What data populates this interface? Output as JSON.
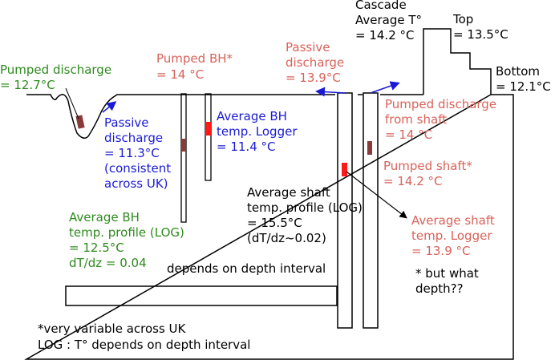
{
  "colors": {
    "green": "#2e8b1e",
    "salmon": "#d9625a",
    "blue": "#1a1ad6",
    "black": "#000000",
    "logger_red": "#ff1a1a",
    "logger_brown": "#8b3a3a"
  },
  "labels": {
    "pumped_discharge": [
      "Pumped discharge",
      "= 12.7°C"
    ],
    "pumped_bh": [
      "Pumped BH*",
      "= 14 °C"
    ],
    "passive_discharge_top": [
      "Passive",
      "discharge",
      "= 13.9°C"
    ],
    "cascade": [
      "Cascade",
      "Average T°",
      "= 14.2 °C"
    ],
    "top": [
      "Top",
      "= 13.5°C"
    ],
    "bottom": [
      "Bottom",
      "= 12.1°C"
    ],
    "passive_discharge_uk": [
      "Passive",
      "discharge",
      "= 11.3°C",
      "(consistent",
      "across UK)"
    ],
    "average_bh_logger": [
      "Average BH",
      "temp. Logger",
      "= 11.4 °C"
    ],
    "pumped_discharge_shaft": [
      "Pumped discharge",
      "from shaft",
      "= 14 °C"
    ],
    "pumped_shaft": [
      "Pumped shaft*",
      "= 14.2 °C"
    ],
    "average_shaft_profile": [
      "Average shaft",
      "temp. profile (LOG)",
      "= 15.5°C",
      "(dT/dz~0.02)"
    ],
    "average_bh_profile": [
      "Average BH",
      "temp. profile (LOG)",
      "= 12.5°C",
      "dT/dz = 0.04"
    ],
    "average_shaft_logger": [
      "Average shaft",
      "temp. Logger",
      "= 13.9 °C"
    ],
    "but_what_depth": [
      "* but what",
      "depth??"
    ],
    "depends_depth": [
      "depends on depth interval"
    ],
    "footnote": [
      "*very variable across UK",
      "LOG : T° depends on depth interval"
    ]
  }
}
